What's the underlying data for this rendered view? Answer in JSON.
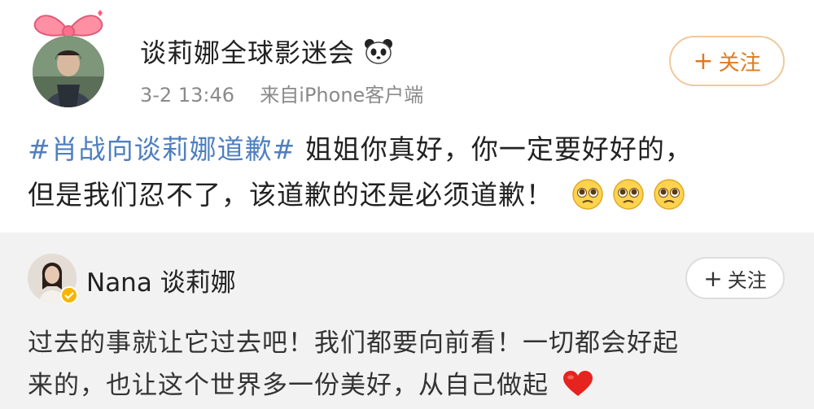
{
  "post": {
    "author": "谈莉娜全球影迷会",
    "date": "3-2",
    "time": "13:46",
    "source": "来自iPhone客户端",
    "follow_label": "关注",
    "follow_plus": "+",
    "hashtag": "#肖战向谈莉娜道歉#",
    "text_line1": "姐姐你真好，你一定要好好的，",
    "text_line2": "但是我们忍不了，该道歉的还是必须道歉！",
    "emoji_icons": [
      "pleading-face-icon",
      "pleading-face-icon",
      "pleading-face-icon"
    ]
  },
  "reply": {
    "author": "Nana 谈莉娜",
    "follow_label": "关注",
    "follow_plus": "+",
    "text_line1": "过去的事就让它过去吧！我们都要向前看！一切都会好起",
    "text_line2": "来的，也让这个世界多一份美好，从自己做起",
    "emoji_icon": "red-heart-icon"
  },
  "colors": {
    "hashtag": "#4f7fc0",
    "follow_accent": "#e07a1f",
    "meta": "#8a8a8a",
    "reply_bg": "#f2f2f2"
  }
}
